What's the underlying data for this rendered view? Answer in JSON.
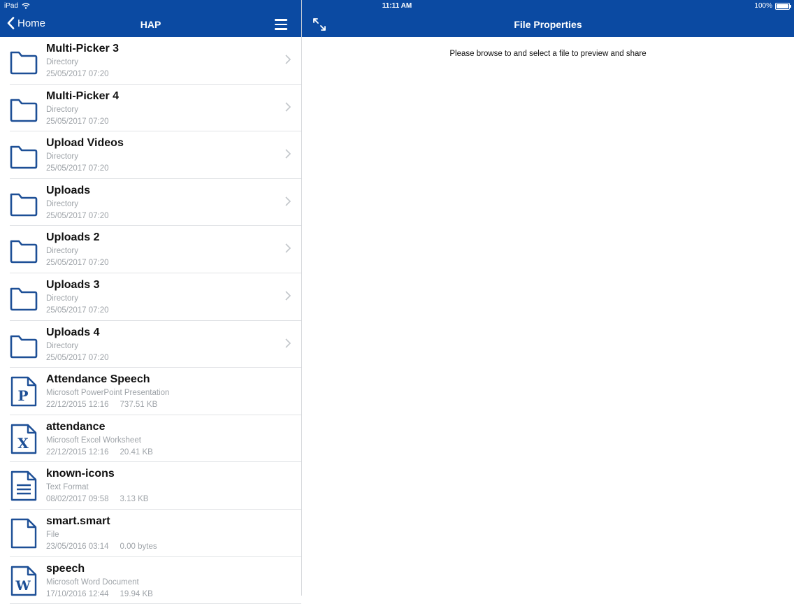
{
  "status": {
    "device": "iPad",
    "time": "11:11 AM",
    "battery": "100%"
  },
  "nav": {
    "back_label": "Home",
    "title": "HAP",
    "detail_title": "File Properties"
  },
  "preview": {
    "message": "Please browse to and select a file to preview and share"
  },
  "files": [
    {
      "name": "Multi-Picker 3",
      "type": "Directory",
      "date": "25/05/2017 07:20",
      "size": "",
      "icon": "folder-icon"
    },
    {
      "name": "Multi-Picker 4",
      "type": "Directory",
      "date": "25/05/2017 07:20",
      "size": "",
      "icon": "folder-icon"
    },
    {
      "name": "Upload Videos",
      "type": "Directory",
      "date": "25/05/2017 07:20",
      "size": "",
      "icon": "folder-icon"
    },
    {
      "name": "Uploads",
      "type": "Directory",
      "date": "25/05/2017 07:20",
      "size": "",
      "icon": "folder-icon"
    },
    {
      "name": "Uploads 2",
      "type": "Directory",
      "date": "25/05/2017 07:20",
      "size": "",
      "icon": "folder-icon"
    },
    {
      "name": "Uploads 3",
      "type": "Directory",
      "date": "25/05/2017 07:20",
      "size": "",
      "icon": "folder-icon"
    },
    {
      "name": "Uploads 4",
      "type": "Directory",
      "date": "25/05/2017 07:20",
      "size": "",
      "icon": "folder-icon"
    },
    {
      "name": "Attendance Speech",
      "type": "Microsoft PowerPoint Presentation",
      "date": "22/12/2015 12:16",
      "size": "737.51 KB",
      "icon": "powerpoint-file-icon"
    },
    {
      "name": "attendance",
      "type": "Microsoft Excel Worksheet",
      "date": "22/12/2015 12:16",
      "size": "20.41 KB",
      "icon": "excel-file-icon"
    },
    {
      "name": "known-icons",
      "type": "Text Format",
      "date": "08/02/2017 09:58",
      "size": "3.13 KB",
      "icon": "text-file-icon"
    },
    {
      "name": "smart.smart",
      "type": "File",
      "date": "23/05/2016 03:14",
      "size": "0.00 bytes",
      "icon": "blank-file-icon"
    },
    {
      "name": "speech",
      "type": "Microsoft Word Document",
      "date": "17/10/2016 12:44",
      "size": "19.94 KB",
      "icon": "word-file-icon"
    }
  ],
  "colors": {
    "nav_bar": "#0b4aa2",
    "icon_blue": "#1d4f96",
    "secondary_text": "#9ea3a8"
  }
}
